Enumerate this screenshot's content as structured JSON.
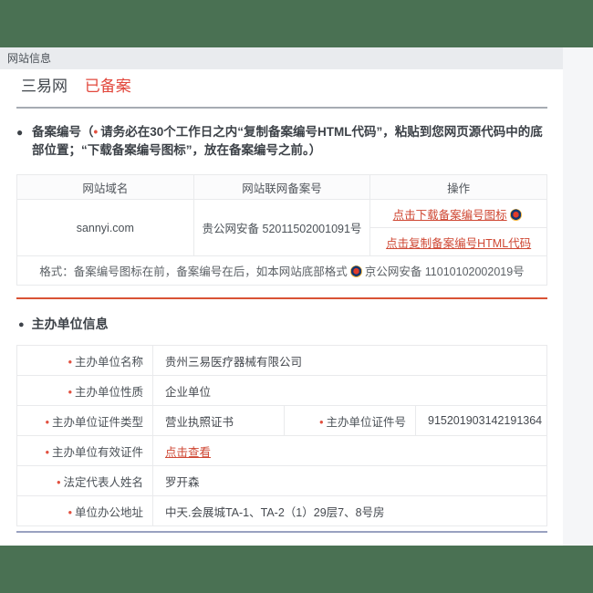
{
  "colors": {
    "accent_green": "#4a7153",
    "status_red": "#e2483d",
    "link_orange": "#cf4733",
    "divider_gray": "#a6acb3",
    "divider_red": "#d95335",
    "divider_blue": "#99a1c0"
  },
  "header": {
    "title": "网站信息"
  },
  "site": {
    "name": "三易网",
    "status": "已备案"
  },
  "icons": {
    "bullet": "●",
    "red_dot": "•",
    "badge": "公安备案徽章"
  },
  "notice": {
    "prefix": "备案编号（",
    "body": "请务必在30个工作日之内“复制备案编号HTML代码”，粘贴到您网页源代码中的底部位置；“下载备案编号图标”，放在备案编号之前。）"
  },
  "filing_table": {
    "headers": [
      "网站域名",
      "网站联网备案号",
      "操作"
    ],
    "row": {
      "domain": "sannyi.com",
      "filing_number": "贵公网安备 52011502001091号",
      "action_download": "点击下载备案编号图标",
      "action_copy": "点击复制备案编号HTML代码"
    },
    "format_note": {
      "prefix": "格式：备案编号图标在前，备案编号在后，如本网站底部格式",
      "suffix": "京公网安备 11010102002019号"
    }
  },
  "organizer": {
    "section_title": "主办单位信息",
    "rows": [
      {
        "label": "主办单位名称",
        "value": "贵州三易医疗器械有限公司"
      },
      {
        "label": "主办单位性质",
        "value": "企业单位"
      },
      {
        "label": "主办单位证件类型",
        "value": "营业执照证书",
        "label2": "主办单位证件号",
        "value2": "915201903142191364"
      },
      {
        "label": "主办单位有效证件",
        "value": "点击查看"
      },
      {
        "label": "法定代表人姓名",
        "value": "罗开森"
      },
      {
        "label": "单位办公地址",
        "value": "中天.会展城TA-1、TA-2（1）29层7、8号房"
      }
    ]
  }
}
